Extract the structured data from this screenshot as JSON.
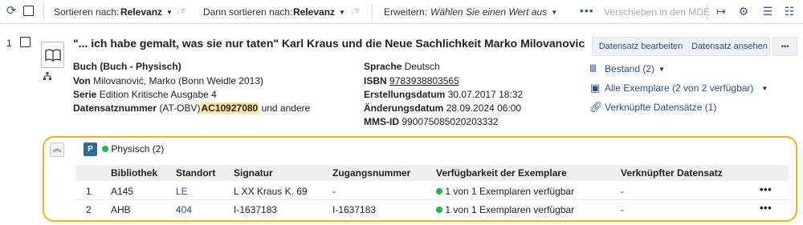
{
  "toolbar": {
    "sort_label": "Sortieren nach:",
    "sort_value": "Relevanz",
    "then_sort_label": "Dann sortieren nach:",
    "then_sort_value": "Relevanz",
    "expand_label": "Erweitern:",
    "expand_placeholder": "Wählen Sie einen Wert aus",
    "move_mde_label": "Verschieben in den MDE"
  },
  "record": {
    "number": "1",
    "title": "\"... ich habe gemalt, was sie nur taten\" Karl Kraus und die Neue Sachlichkeit Marko Milovanovic",
    "buttons": {
      "edit": "Datensatz bearbeiten",
      "view": "Datensatz ansehen",
      "more": "•••"
    },
    "left_fields": {
      "type": "Buch (Buch - Physisch)",
      "von_label": "Von",
      "von_value": "Milovanović, Marko (Bonn Weidle 2013)",
      "serie_label": "Serie",
      "serie_value": "Edition Kritische Ausgabe 4",
      "dsn_label": "Datensatznummer",
      "dsn_prefix": "(AT-OBV)",
      "dsn_value": "AC10927080",
      "dsn_suffix": "und andere"
    },
    "right_fields": {
      "sprache_label": "Sprache",
      "sprache_value": "Deutsch",
      "isbn_label": "ISBN",
      "isbn_value": "9783938803565",
      "erstellung_label": "Erstellungsdatum",
      "erstellung_value": "30.07.2017 18:32",
      "aenderung_label": "Änderungsdatum",
      "aenderung_value": "28.09.2024 06:00",
      "mms_label": "MMS-ID",
      "mms_value": "990075085020203332"
    },
    "side_links": {
      "bestand": "Bestand (2)",
      "exemplare": "Alle Exemplare (2 von 2 verfügbar)",
      "verknuepft": "Verknüpfte Datensätze (1)"
    }
  },
  "holdings": {
    "badge": "P",
    "label": "Physisch (2)",
    "columns": [
      "Bibliothek",
      "Standort",
      "Signatur",
      "Zugangsnummer",
      "Verfügbarkeit der Exemplare",
      "Verknüpfter Datensatz"
    ],
    "rows": [
      {
        "num": "1",
        "bibliothek": "A145",
        "standort": "LE",
        "signatur": "L XX Kraus K. 69",
        "zugangsnummer": "-",
        "verfuegbarkeit": "1 von 1 Exemplaren verfügbar",
        "verknuepft": "-"
      },
      {
        "num": "2",
        "bibliothek": "AHB",
        "standort": "404",
        "signatur": "I-1637183",
        "zugangsnummer": "I-1637183",
        "verfuegbarkeit": "1 von 1 Exemplaren verfügbar",
        "verknuepft": "-"
      }
    ],
    "row_menu": "•••"
  },
  "colors": {
    "accent": "#2a4f86",
    "highlight_border": "#f2b21b",
    "available": "#2bb24c",
    "badge": "#2e6aa3"
  },
  "icons": [
    "refresh-icon",
    "sort-disabled-icon",
    "export-icon",
    "gear-icon",
    "list-view-icon",
    "book-icon",
    "hierarchy-icon",
    "library-icon",
    "item-barcode-icon",
    "link-icon",
    "collapse-icon"
  ]
}
